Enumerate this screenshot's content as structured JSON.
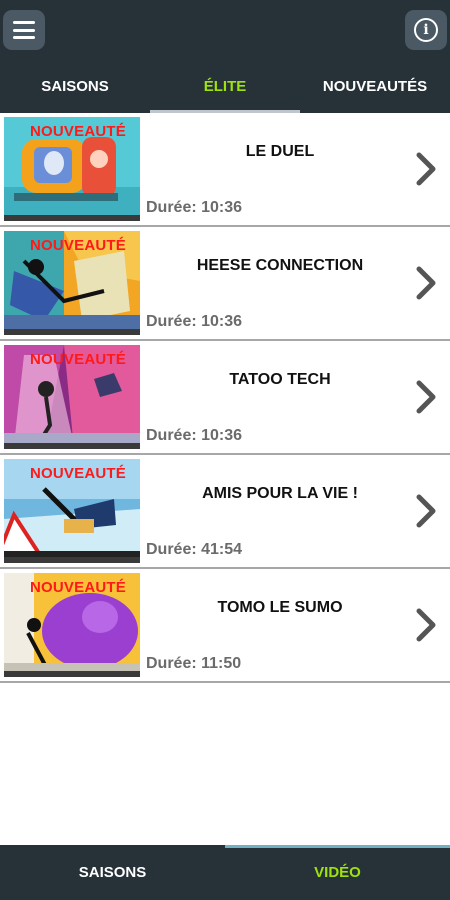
{
  "header": {
    "menu_icon": "hamburger-menu-icon",
    "info_icon": "info-icon"
  },
  "tabs": [
    {
      "label": "SAISONS",
      "active": false
    },
    {
      "label": "ÉLITE",
      "active": true
    },
    {
      "label": "NOUVEAUTÉS",
      "active": false
    }
  ],
  "episodes": [
    {
      "badge": "NOUVEAUTÉ",
      "title": "LE DUEL",
      "duration": "Durée: 10:36"
    },
    {
      "badge": "NOUVEAUTÉ",
      "title": "HEESE CONNECTION",
      "duration": "Durée: 10:36"
    },
    {
      "badge": "NOUVEAUTÉ",
      "title": "TATOO TECH",
      "duration": "Durée: 10:36"
    },
    {
      "badge": "NOUVEAUTÉ",
      "title": "AMIS POUR LA VIE !",
      "duration": "Durée: 41:54"
    },
    {
      "badge": "NOUVEAUTÉ",
      "title": "TOMO LE SUMO",
      "duration": "Durée: 11:50"
    }
  ],
  "bottom_nav": [
    {
      "label": "SAISONS",
      "active": false
    },
    {
      "label": "VIDÉO",
      "active": true
    }
  ],
  "colors": {
    "bar_bg": "#263238",
    "accent": "#9fe30c",
    "badge": "#ff1a1a"
  }
}
